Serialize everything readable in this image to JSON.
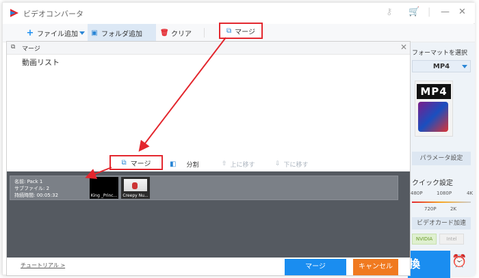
{
  "app": {
    "title": "ビデオコンバータ"
  },
  "toolbar": {
    "add_file": "ファイル追加",
    "add_folder": "フォルダ追加",
    "clear": "クリア",
    "merge": "マージ"
  },
  "right_panel": {
    "format_label": "フォーマットを選択",
    "format_value": "MP4",
    "format_icon_text": "MP4",
    "param_button": "パラメータ設定",
    "quick_label": "クイック設定",
    "res_top": [
      "480P",
      "1080P",
      "4K"
    ],
    "res_bottom": [
      "720P",
      "2K"
    ],
    "gpu_button": "ビデオカード加速",
    "nvidia": "NVIDIA",
    "intel": "Intel",
    "run_label": "換"
  },
  "dialog": {
    "title": "マージ",
    "list_title": "動画リスト",
    "actions": {
      "merge": "マージ",
      "split": "分割",
      "move_up": "上に移す",
      "move_down": "下に移す"
    },
    "pack": {
      "name": "名前: Pack 1",
      "subfiles": "サブファイル: 2",
      "duration": "持続時間: 00:05:32",
      "items": [
        {
          "caption": "King _Princ..."
        },
        {
          "caption": "Creepy Nu..."
        }
      ]
    },
    "footer": {
      "tutorial": "チュートリアル >",
      "merge_button": "マージ",
      "cancel_button": "キャンセル"
    }
  },
  "colors": {
    "accent_blue": "#1a8df0",
    "highlight_red": "#e3262d",
    "cancel_orange": "#f07a20",
    "dark_panel": "#555a61"
  }
}
